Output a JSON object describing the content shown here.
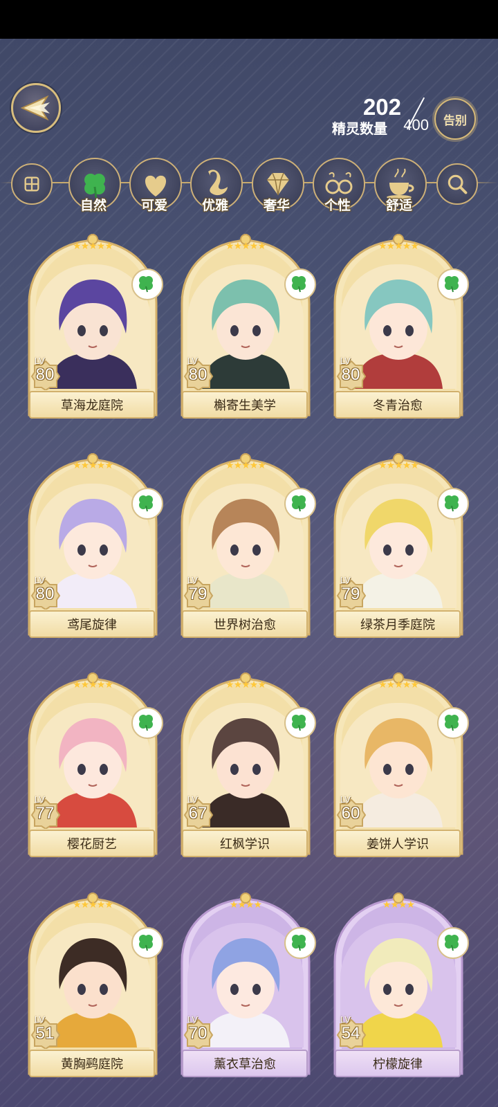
{
  "header": {
    "back_icon": "back-arrow-icon",
    "count_current": "202",
    "count_label": "精灵数量",
    "count_max": "400",
    "farewell_label": "告别"
  },
  "filters": [
    {
      "label": "",
      "icon": "grid-icon"
    },
    {
      "label": "自然",
      "icon": "clover-icon"
    },
    {
      "label": "可爱",
      "icon": "heart-icon"
    },
    {
      "label": "优雅",
      "icon": "swan-icon"
    },
    {
      "label": "奢华",
      "icon": "diamond-icon"
    },
    {
      "label": "个性",
      "icon": "glasses-icon"
    },
    {
      "label": "舒适",
      "icon": "teacup-icon"
    },
    {
      "label": "",
      "icon": "search-icon"
    }
  ],
  "colors": {
    "accent_gold": "#d6b978",
    "card_gold": "#f4e3b3",
    "card_purple": "#dcc7ee",
    "bg": "#4b5374"
  },
  "spirits": [
    {
      "name": "草海龙庭院",
      "level": "80",
      "level_tag": "LV",
      "stars": "★★★★★",
      "hair": "#5b46a0",
      "skin": "#f9e3d3",
      "cloth": "#3a2f5c"
    },
    {
      "name": "槲寄生美学",
      "level": "80",
      "level_tag": "LV",
      "stars": "★★★★★",
      "hair": "#7cc0ad",
      "skin": "#fbe5d5",
      "cloth": "#2d3b38"
    },
    {
      "name": "冬青治愈",
      "level": "80",
      "level_tag": "LV",
      "stars": "★★★★★",
      "hair": "#86c7c0",
      "skin": "#fde7d8",
      "cloth": "#b13d3c"
    },
    {
      "name": "鸢尾旋律",
      "level": "80",
      "level_tag": "LV",
      "stars": "★★★★★",
      "hair": "#b9aae6",
      "skin": "#fde9dc",
      "cloth": "#f2ecf8"
    },
    {
      "name": "世界树治愈",
      "level": "79",
      "level_tag": "LV",
      "stars": "★★★★★",
      "hair": "#b78559",
      "skin": "#fde7d5",
      "cloth": "#e8e6c9"
    },
    {
      "name": "绿茶月季庭院",
      "level": "79",
      "level_tag": "LV",
      "stars": "★★★★★",
      "hair": "#f0d76a",
      "skin": "#fde9dc",
      "cloth": "#f4f2e6"
    },
    {
      "name": "樱花厨艺",
      "level": "77",
      "level_tag": "LV",
      "stars": "★★★★★",
      "hair": "#f2b4c2",
      "skin": "#fde8dd",
      "cloth": "#d74b3f"
    },
    {
      "name": "红枫学识",
      "level": "67",
      "level_tag": "LV",
      "stars": "★★★★★",
      "hair": "#5b4540",
      "skin": "#fce2d2",
      "cloth": "#3a2b27"
    },
    {
      "name": "姜饼人学识",
      "level": "60",
      "level_tag": "LV",
      "stars": "★★★★★",
      "hair": "#e8b766",
      "skin": "#fde5d2",
      "cloth": "#f5ece0"
    },
    {
      "name": "黄胸鹀庭院",
      "level": "51",
      "level_tag": "LV",
      "stars": "★★★★★",
      "hair": "#3d2c25",
      "skin": "#fbe0cc",
      "cloth": "#e6a93b"
    },
    {
      "name": "薰衣草治愈",
      "level": "70",
      "level_tag": "LV",
      "stars": "★★★★",
      "hair": "#8fa3e3",
      "skin": "#fde9e0",
      "cloth": "#f3f1f8"
    },
    {
      "name": "柠檬旋律",
      "level": "54",
      "level_tag": "LV",
      "stars": "★★★★",
      "hair": "#f1ebbb",
      "skin": "#fde8d8",
      "cloth": "#f0d54a"
    }
  ]
}
